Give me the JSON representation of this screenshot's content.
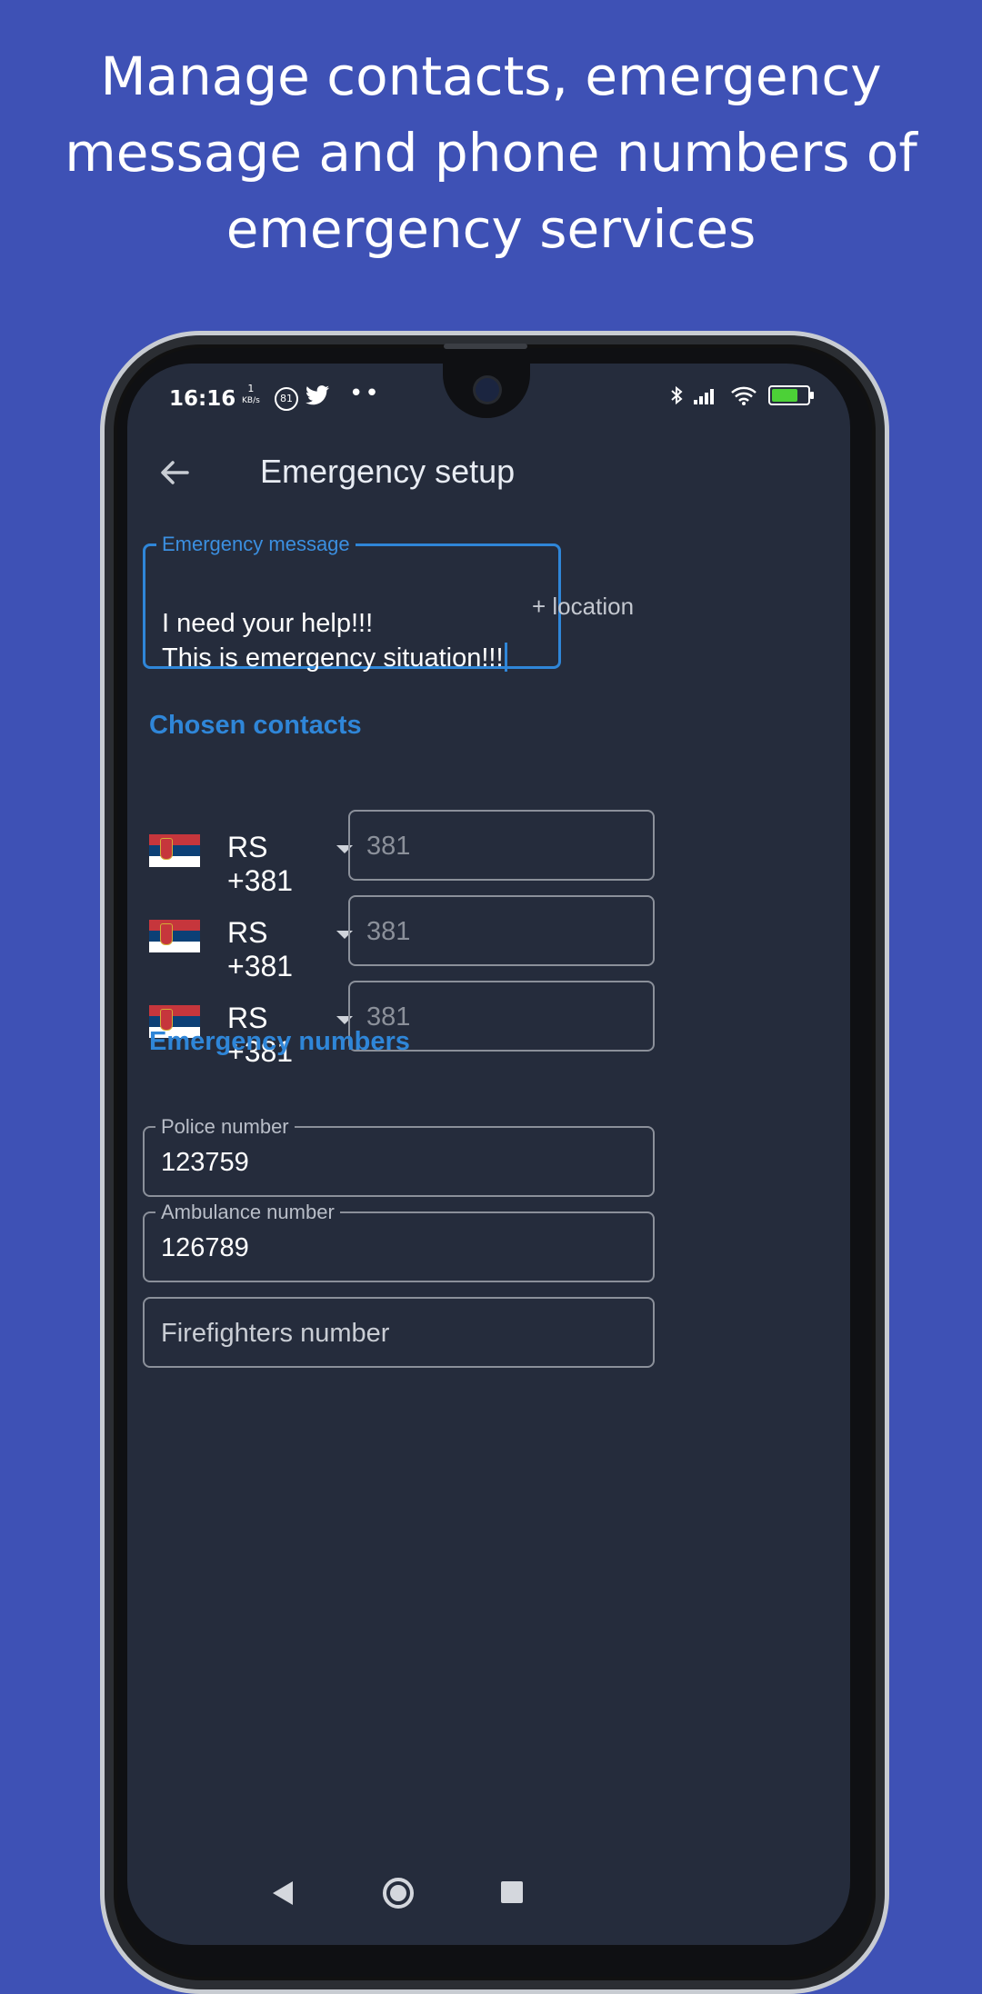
{
  "headline": "Manage contacts, emergency message and phone numbers of emergency services",
  "status_bar": {
    "time": "16:16",
    "speed_value": "1",
    "speed_unit": "KB/s",
    "badge": "81",
    "icons": [
      "twitter-icon",
      "more-dots-icon",
      "bluetooth-icon",
      "signal-icon",
      "wifi-icon",
      "battery-charging-icon"
    ]
  },
  "appbar": {
    "title": "Emergency setup"
  },
  "message_field": {
    "label": "Emergency message",
    "value": "I need your help!!!\nThis is emergency situation!!!"
  },
  "location_button": "+ location",
  "contacts": {
    "heading": "Chosen contacts",
    "items": [
      {
        "country": "RS  +381",
        "placeholder": "381"
      },
      {
        "country": "RS  +381",
        "placeholder": "381"
      },
      {
        "country": "RS  +381",
        "placeholder": "381"
      }
    ]
  },
  "emergency_numbers": {
    "heading": "Emergency numbers",
    "police": {
      "label": "Police number",
      "value": "123759"
    },
    "ambulance": {
      "label": "Ambulance number",
      "value": "126789"
    },
    "firefighters": {
      "placeholder": "Firefighters number"
    }
  },
  "colors": {
    "background": "#3e51b5",
    "screen": "#252c3c",
    "accent": "#2f86d8"
  }
}
